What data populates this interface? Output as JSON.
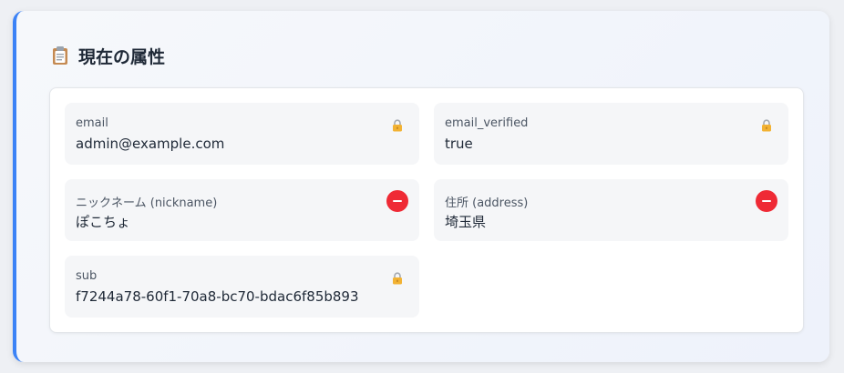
{
  "panel": {
    "title": "現在の属性",
    "title_icon": "clipboard-icon",
    "accent_color": "#3b82f6"
  },
  "attributes": [
    {
      "label": "email",
      "value": "admin@example.com",
      "action": "lock-icon"
    },
    {
      "label": "email_verified",
      "value": "true",
      "action": "lock-icon"
    },
    {
      "label": "ニックネーム (nickname)",
      "value": "ぽこちょ",
      "action": "remove-button",
      "action_color": "#ef2a35"
    },
    {
      "label": "住所 (address)",
      "value": "埼玉県",
      "action": "remove-button",
      "action_color": "#ef2a35"
    },
    {
      "label": "sub",
      "value": "f7244a78-60f1-70a8-bc70-bdac6f85b893",
      "action": "lock-icon"
    }
  ]
}
